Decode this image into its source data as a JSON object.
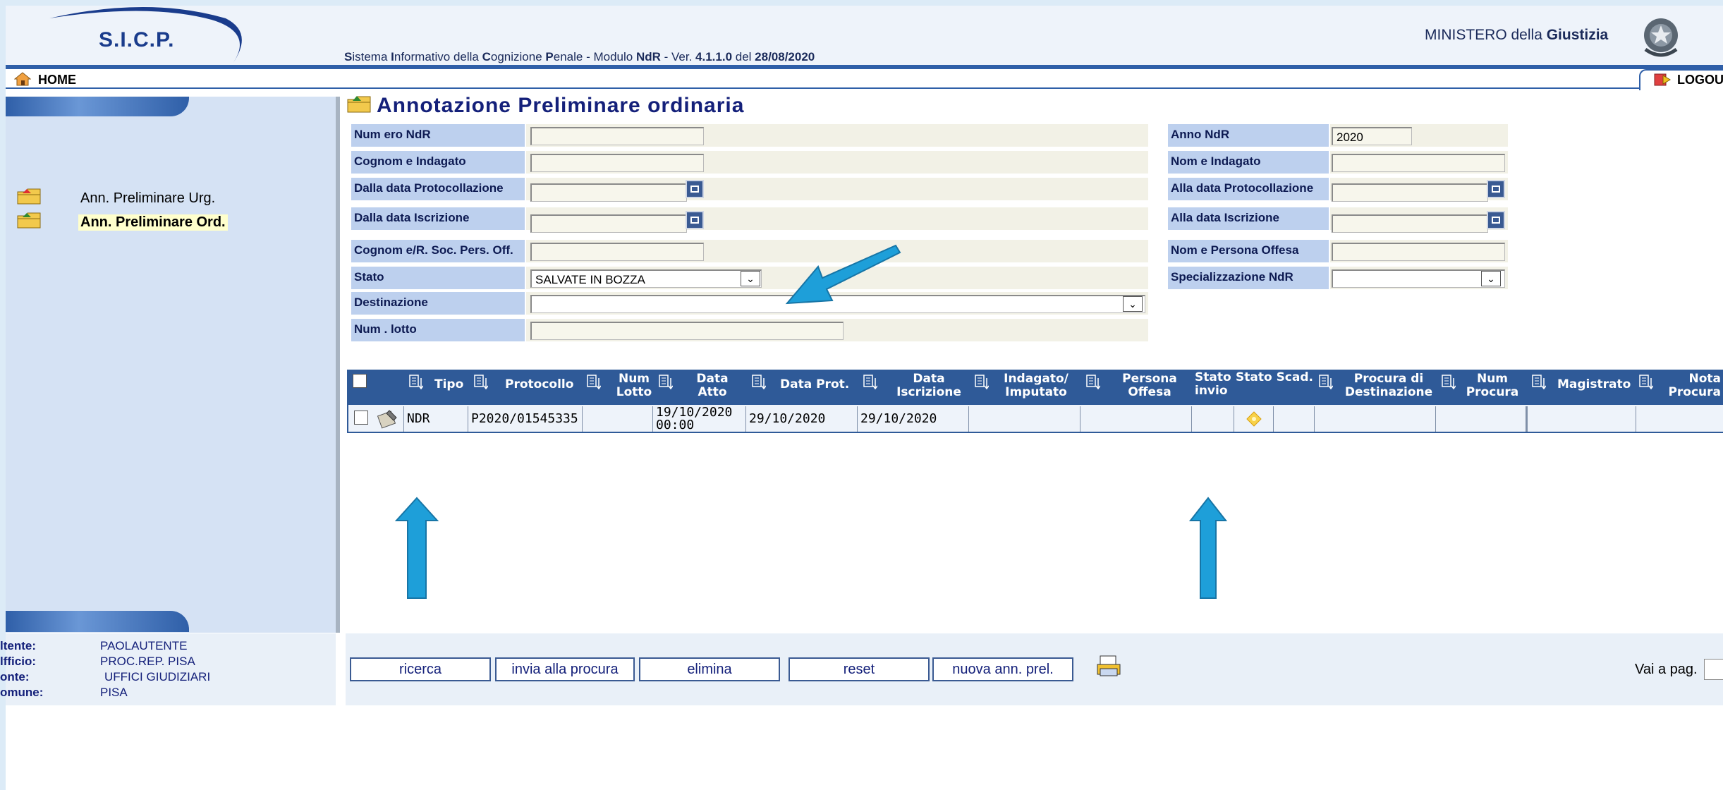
{
  "header": {
    "logo": "S.I.C.P.",
    "sys_title_parts": [
      "S",
      "istema ",
      "I",
      "nformativo della ",
      "C",
      "ognizione ",
      "P",
      "enale - Modulo ",
      "NdR",
      " - Ver. ",
      "4.1.1.0",
      " del ",
      "28/08/2020"
    ],
    "ministero_prefix": "MINISTERO della ",
    "ministero_bold": "Giustizia"
  },
  "nav": {
    "home": "HOME",
    "logout": "LOGOU"
  },
  "sidebar": {
    "items": [
      {
        "label": "Ann. Preliminare Urg.",
        "selected": false
      },
      {
        "label": "Ann. Preliminare Ord.",
        "selected": true
      }
    ]
  },
  "main": {
    "title": "Annotazione Preliminare ordinaria",
    "form": {
      "numero_ndr": {
        "label": "Num ero NdR",
        "value": ""
      },
      "anno_ndr": {
        "label": "Anno NdR",
        "value": "2020"
      },
      "cognome_indagato": {
        "label": "Cognom e Indagato",
        "value": ""
      },
      "nome_indagato": {
        "label": "Nom e Indagato",
        "value": ""
      },
      "dalla_data_prot": {
        "label": "Dalla data Protocollazione",
        "value": ""
      },
      "alla_data_prot": {
        "label": "Alla data Protocollazione",
        "value": ""
      },
      "dalla_data_iscr": {
        "label": "Dalla data Iscrizione",
        "value": ""
      },
      "alla_data_iscr": {
        "label": "Alla data Iscrizione",
        "value": ""
      },
      "cognome_pers_off": {
        "label": "Cognom e/R. Soc. Pers. Off.",
        "value": ""
      },
      "nome_pers_off": {
        "label": "Nom e Persona Offesa",
        "value": ""
      },
      "stato": {
        "label": "Stato",
        "value": "SALVATE IN BOZZA"
      },
      "specializzazione": {
        "label": "Specializzazione NdR",
        "value": ""
      },
      "destinazione": {
        "label": "Destinazione",
        "value": ""
      },
      "num_lotto": {
        "label": "Num . lotto",
        "value": ""
      }
    },
    "table": {
      "headers": {
        "tipo": "Tipo",
        "protocollo": "Protocollo",
        "num_lotto": "Num\nLotto",
        "data_atto": "Data\nAtto",
        "data_prot": "Data Prot.",
        "data_iscrizione": "Data\nIscrizione",
        "indagato": "Indagato/\nImputato",
        "persona_offesa": "Persona\nOffesa",
        "stato_invio": "Stato\ninvio",
        "stato_scad": "Stato Scad.",
        "procura_dest": "Procura di\nDestinazione",
        "num_procura": "Num\nProcura",
        "magistrato": "Magistrato",
        "nota_procura": "Nota\nProcura"
      },
      "rows": [
        {
          "tipo": "NDR",
          "protocollo": "P2020/01545335",
          "num_lotto": "",
          "data_atto": "19/10/2020\n00:00",
          "data_prot": "29/10/2020",
          "data_iscrizione": "29/10/2020"
        }
      ]
    }
  },
  "footer": {
    "info": [
      {
        "key": "ltente:",
        "value": "PAOLAUTENTE"
      },
      {
        "key": "lfficio:",
        "value": "PROC.REP. PISA"
      },
      {
        "key": "onte:",
        "value": "UFFICI GIUDIZIARI"
      },
      {
        "key": "omune:",
        "value": "PISA"
      }
    ],
    "buttons": {
      "ricerca": "ricerca",
      "invia": "invia alla procura",
      "elimina": "elimina",
      "reset": "reset",
      "nuova": "nuova ann. prel."
    },
    "vai_a_pag": "Vai a pag."
  },
  "colors": {
    "label_bg": "#bdd0ee",
    "table_header_bg": "#2f5a98",
    "arrow": "#1e9fd9",
    "title": "#14207a"
  }
}
